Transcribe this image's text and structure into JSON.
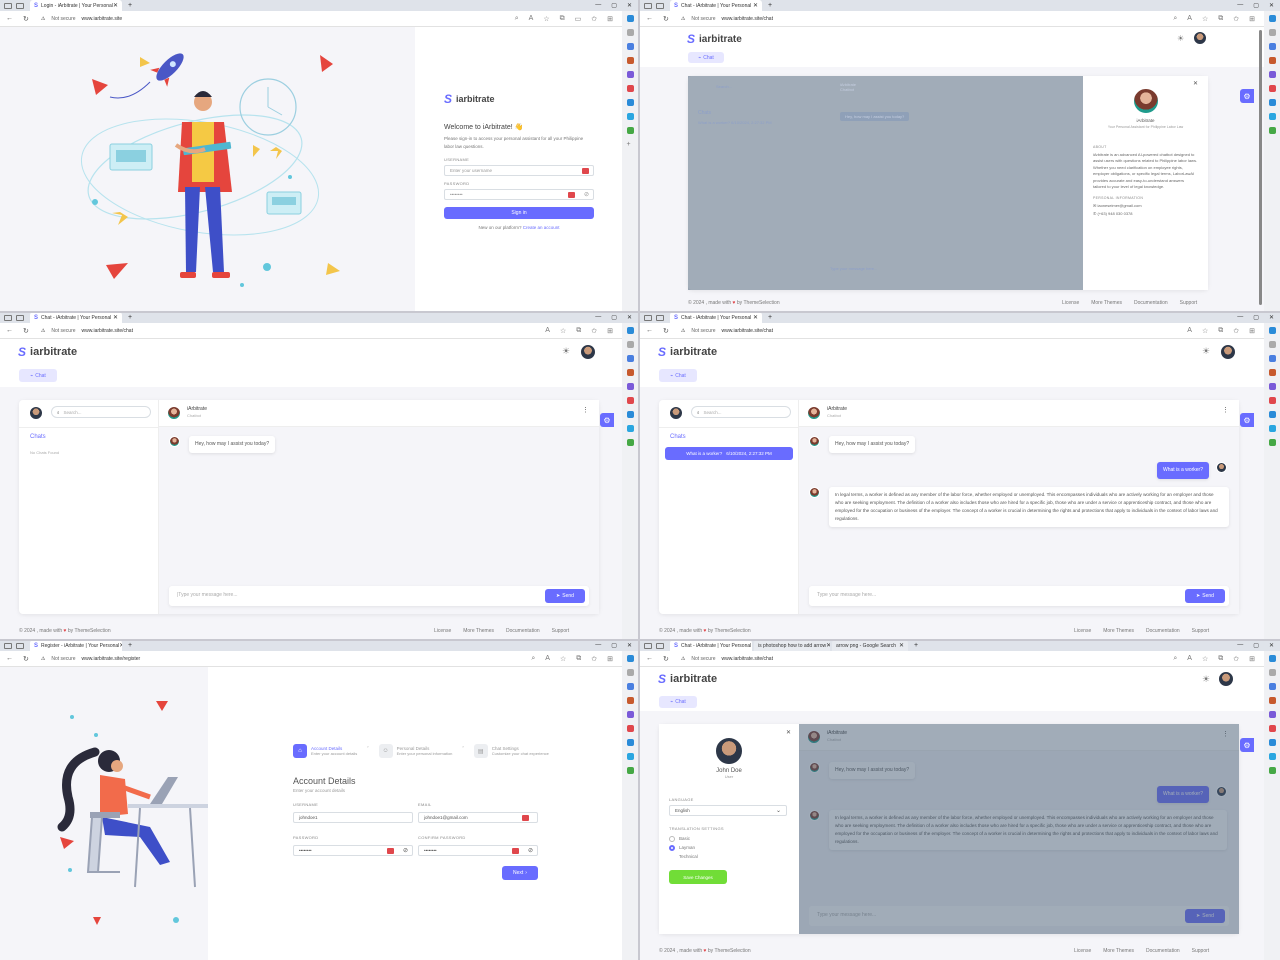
{
  "browser": {
    "tab_login": "Login - iArbitrate | Your Personal",
    "tab_chat": "Chat - iArbitrate | Your Personal",
    "tab_register": "Register - iArbitrate | Your Personal",
    "tab_ps": "is photoshop how to add arrow",
    "tab_arrow": "arrow png - Google Search",
    "not_secure": "Not secure",
    "url_root": "www.iarbitrate.site",
    "url_chat": "www.iarbitrate.site/chat",
    "url_register": "www.iarbitrate.site/register"
  },
  "brand": {
    "name": "iarbitrate",
    "logo_glyph": "S"
  },
  "login": {
    "welcome": "Welcome to iArbitrate! 👋",
    "subtitle": "Please sign-in to access your personal assistant for all your Philippine labor law questions.",
    "username_label": "USERNAME",
    "username_placeholder": "Enter your username",
    "password_label": "PASSWORD",
    "password_placeholder": "••••••••",
    "signin": "Sign in",
    "new_text": "New on our platform?",
    "create_link": "Create an account"
  },
  "chat": {
    "nav_chat": "Chat",
    "search_placeholder": "Search...",
    "chats_title": "Chats",
    "no_chats": "No Chats Found",
    "history_item": "What is a worker?",
    "history_date": "6/10/2024, 2:27:32 PM",
    "bot_name": "iArbitrate",
    "bot_role": "Chatbot",
    "greeting": "Hey, how may I assist you today?",
    "user_question": "What is a worker?",
    "answer": "In legal terms, a worker is defined as any member of the labor force, whether employed or unemployed. This encompasses individuals who are actively working for an employer and those who are seeking employment. The definition of a worker also includes those who are hired for a specific job, those who are under a service or apprenticeship contract, and those who are employed for the occupation or business of the employer. The concept of a worker is crucial in determining the rights and protections that apply to individuals in the context of labor laws and regulations.",
    "input_placeholder": "Type your message here...",
    "input_placeholder_cursor": "|Type your message here...",
    "send": "Send"
  },
  "profile": {
    "name": "iArbitrate",
    "tagline": "Your Personal Assistant for Philippine Labor Law",
    "about_title": "ABOUT",
    "about_text": "iArbitrate is an advanced AI-powered chatbot designed to assist users with questions related to Philippine labor laws. Whether you need clarification on employee rights, employer obligations, or specific legal terms, LaborLawAI provides accurate and easy-to-understand answers tailored to your level of legal knowledge.",
    "personal_title": "PERSONAL INFORMATION",
    "email": "iaoneseimer@gmail.com",
    "phone": "(+63) 948 030 0378"
  },
  "user_settings": {
    "name": "John Doe",
    "role": "User",
    "language_label": "LANGUAGE",
    "language_value": "English",
    "translation_label": "TRANSLATION SETTINGS",
    "options": [
      "Basic",
      "Layman",
      "Technical"
    ],
    "selected_option": "Layman",
    "save": "Save Changes"
  },
  "register": {
    "step1_title": "Account Details",
    "step1_sub": "Enter your account details",
    "step2_title": "Personal Details",
    "step2_sub": "Enter your personal information",
    "step3_title": "Chat Settings",
    "step3_sub": "Customize your chat experience",
    "heading": "Account Details",
    "heading_sub": "Enter your account details",
    "username_label": "USERNAME",
    "username_value": "johndoe1",
    "email_label": "EMAIL",
    "email_value": "johndoe1@gmail.com",
    "password_label": "PASSWORD",
    "password_value": "••••••••",
    "confirm_label": "CONFIRM PASSWORD",
    "confirm_value": "••••••••",
    "next": "Next"
  },
  "footer": {
    "copyright": "© 2024 , made with",
    "by": "by ThemeSelection",
    "links": [
      "License",
      "More Themes",
      "Documentation",
      "Support"
    ]
  },
  "colors": {
    "primary": "#696cff",
    "success": "#71dd37",
    "danger": "#e0474c"
  }
}
